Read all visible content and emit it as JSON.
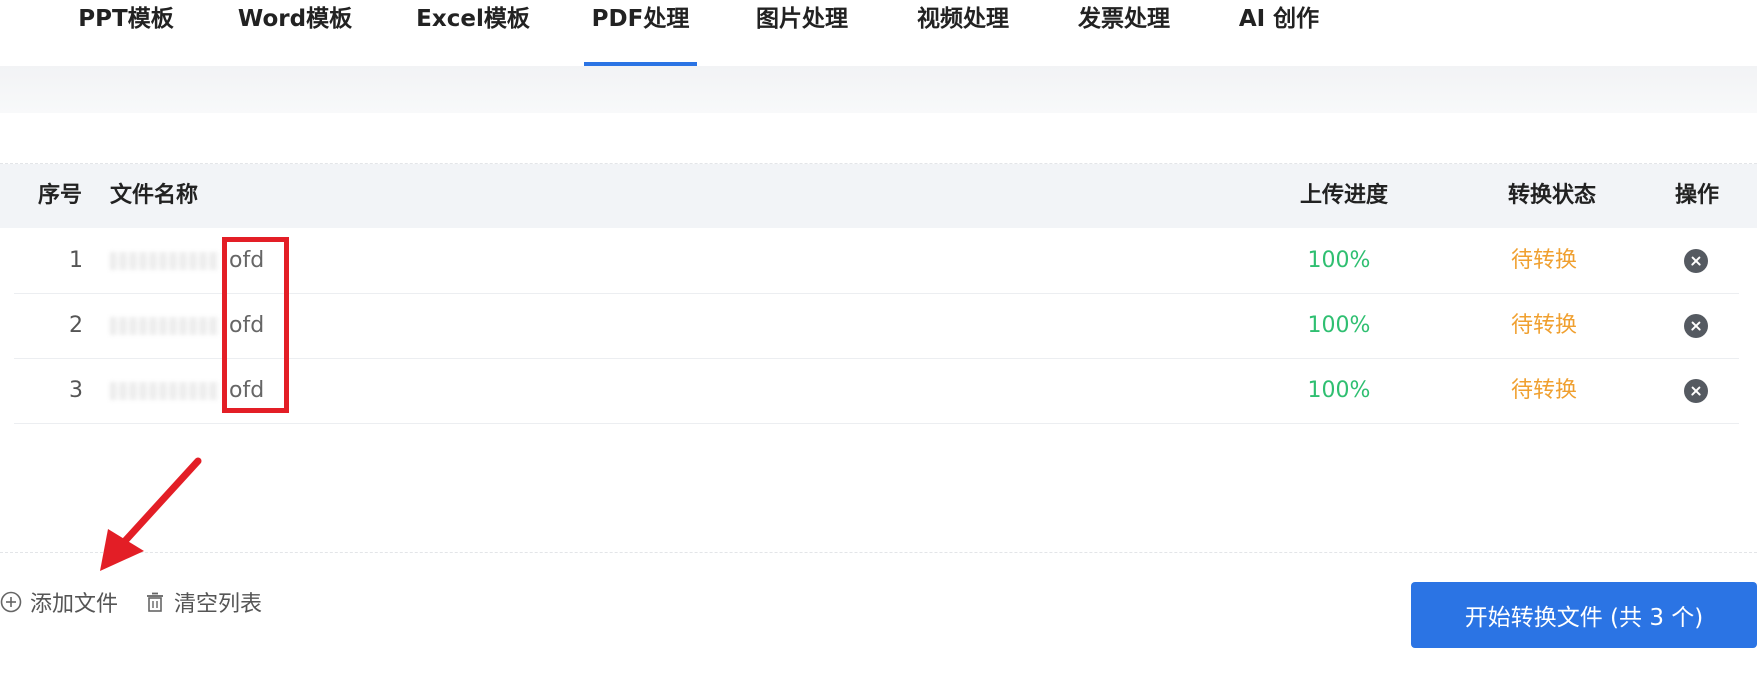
{
  "nav": {
    "tabs": [
      {
        "label": "PPT模板"
      },
      {
        "label": "Word模板"
      },
      {
        "label": "Excel模板"
      },
      {
        "label": "PDF处理",
        "active": true
      },
      {
        "label": "图片处理"
      },
      {
        "label": "视频处理"
      },
      {
        "label": "发票处理"
      },
      {
        "label": "AI 创作"
      }
    ]
  },
  "table": {
    "headers": {
      "index": "序号",
      "name": "文件名称",
      "progress": "上传进度",
      "status": "转换状态",
      "operation": "操作"
    },
    "rows": [
      {
        "index": "1",
        "name_suffix": ".ofd",
        "progress": "100%",
        "status": "待转换"
      },
      {
        "index": "2",
        "name_suffix": ".ofd",
        "progress": "100%",
        "status": "待转换"
      },
      {
        "index": "3",
        "name_suffix": ".ofd",
        "progress": "100%",
        "status": "待转换"
      }
    ]
  },
  "footer": {
    "add_file": "添加文件",
    "clear_list": "清空列表",
    "start_button": "开始转换文件 (共 3 个)"
  },
  "colors": {
    "accent": "#2b74e4",
    "progress_green": "#2fbf71",
    "status_orange": "#f0a030",
    "annotation_red": "#e31e26"
  }
}
